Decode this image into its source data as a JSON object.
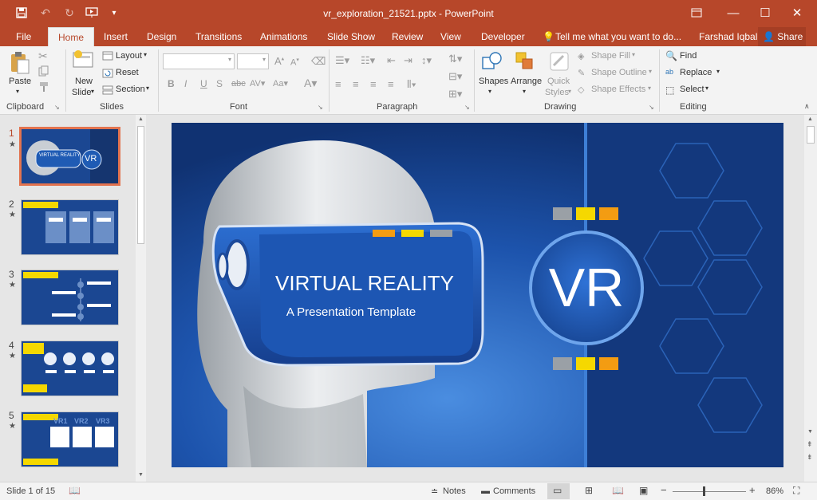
{
  "window": {
    "title": "vr_exploration_21521.pptx - PowerPoint"
  },
  "tabs": [
    {
      "label": "File"
    },
    {
      "label": "Home"
    },
    {
      "label": "Insert"
    },
    {
      "label": "Design"
    },
    {
      "label": "Transitions"
    },
    {
      "label": "Animations"
    },
    {
      "label": "Slide Show"
    },
    {
      "label": "Review"
    },
    {
      "label": "View"
    },
    {
      "label": "Developer"
    }
  ],
  "tell_me": "Tell me what you want to do...",
  "user": "Farshad Iqbal",
  "share": "Share",
  "ribbon": {
    "clipboard": {
      "paste": "Paste",
      "label": "Clipboard"
    },
    "slides": {
      "new_slide_1": "New",
      "new_slide_2": "Slide",
      "layout": "Layout",
      "reset": "Reset",
      "section": "Section",
      "label": "Slides"
    },
    "font": {
      "label": "Font"
    },
    "paragraph": {
      "label": "Paragraph"
    },
    "drawing": {
      "shapes": "Shapes",
      "arrange": "Arrange",
      "quick_1": "Quick",
      "quick_2": "Styles",
      "shape_fill": "Shape Fill",
      "shape_outline": "Shape Outline",
      "shape_effects": "Shape Effects",
      "label": "Drawing"
    },
    "editing": {
      "find": "Find",
      "replace": "Replace",
      "select": "Select",
      "label": "Editing"
    }
  },
  "thumbnails": [
    {
      "num": "1",
      "title": "VIRTUAL REALITY",
      "badge": "VR"
    },
    {
      "num": "2"
    },
    {
      "num": "3"
    },
    {
      "num": "4"
    },
    {
      "num": "5",
      "vr_labels": [
        "VR1",
        "VR2",
        "VR3"
      ]
    }
  ],
  "slide": {
    "title": "VIRTUAL REALITY",
    "subtitle": "A Presentation Template",
    "badge": "VR",
    "colors": {
      "bg": "#13377c",
      "accent_orange": "#f39c12",
      "accent_yellow": "#f5d800",
      "accent_gray": "#9aa0a6"
    }
  },
  "status": {
    "slide_info": "Slide 1 of 15",
    "notes": "Notes",
    "comments": "Comments",
    "zoom": "86%"
  },
  "colors": {
    "brand": "#b7472a",
    "ribbon": "#f3f3f3"
  }
}
